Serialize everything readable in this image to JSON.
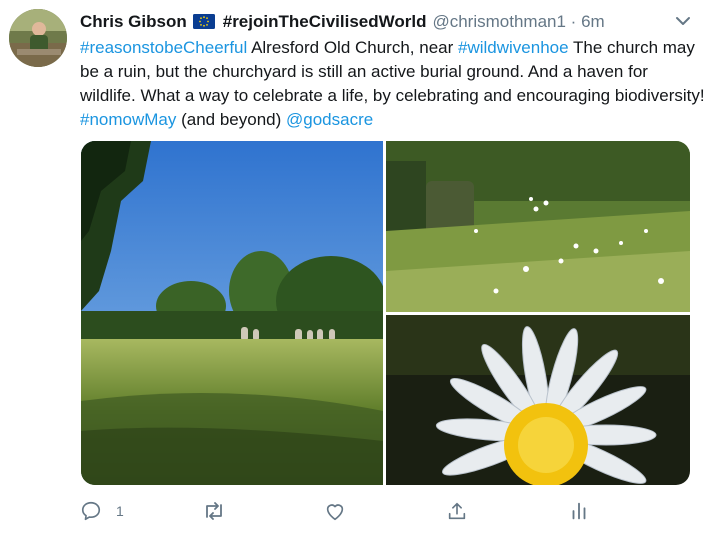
{
  "tweet": {
    "author_name": "Chris Gibson",
    "flag_icon": "eu-flag-icon",
    "display_tag": "#rejoinTheCivilisedWorld",
    "handle": "@chrismothman1",
    "separator": "·",
    "timestamp": "6m",
    "body": [
      {
        "text": "#reasonstobeCheerful",
        "link": true
      },
      {
        "text": " Alresford Old Church, near ",
        "link": false
      },
      {
        "text": "#wildwivenhoe",
        "link": true
      },
      {
        "text": " The church may be a ruin, but the churchyard is still an active burial ground. And a haven for wildlife. What a way to celebrate a life, by celebrating and encouraging biodiversity! ",
        "link": false
      },
      {
        "text": "#nomowMay",
        "link": true
      },
      {
        "text": " (and beyond) ",
        "link": false
      },
      {
        "text": "@godsacre",
        "link": true
      }
    ],
    "link_color": "#1b95e0"
  },
  "actions": {
    "reply_count": "1",
    "icons": [
      "reply-icon",
      "retweet-icon",
      "like-icon",
      "share-icon",
      "analytics-icon"
    ]
  }
}
